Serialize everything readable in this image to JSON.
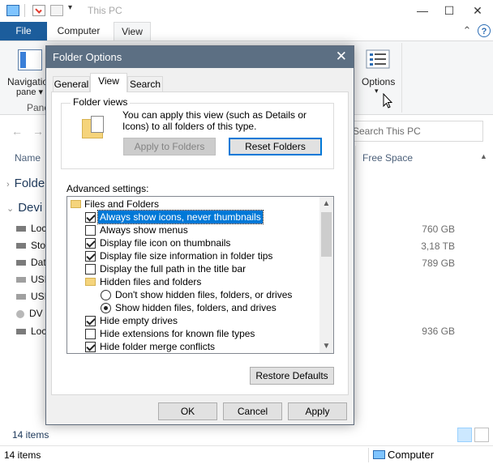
{
  "explorer": {
    "window_title": "This PC",
    "tabs": {
      "file": "File",
      "computer": "Computer",
      "view": "View"
    },
    "ribbon": {
      "nav_pane_label_1": "Navigation",
      "nav_pane_label_2": "pane ▾",
      "panes_group_label": "Pane",
      "options_label": "Options",
      "options_arrow": "▾"
    },
    "search_placeholder": "Search This PC",
    "columns": {
      "name": "Name",
      "free_space": "Free Space"
    },
    "sidebar": {
      "folders": "Folde",
      "devices": "Devi"
    },
    "drives": [
      {
        "label": "Loc",
        "free": "760 GB"
      },
      {
        "label": "Sto",
        "free": "3,18 TB"
      },
      {
        "label": "Dat",
        "free": "789 GB"
      },
      {
        "label": "USI",
        "free": ""
      },
      {
        "label": "USI",
        "free": ""
      },
      {
        "label": "DV",
        "free": ""
      },
      {
        "label": "Loc",
        "free": "936 GB"
      }
    ],
    "item_count": "14 items",
    "status_left": "14 items",
    "status_right": "Computer"
  },
  "dialog": {
    "title": "Folder Options",
    "tabs": [
      "General",
      "View",
      "Search"
    ],
    "active_tab": "View",
    "folder_views": {
      "label": "Folder views",
      "description": "You can apply this view (such as Details or Icons) to all folders of this type.",
      "apply_button": "Apply to Folders",
      "reset_button": "Reset Folders"
    },
    "advanced_label": "Advanced settings:",
    "advanced_items": [
      {
        "kind": "folder",
        "text": "Files and Folders"
      },
      {
        "kind": "check",
        "checked": true,
        "selected": true,
        "text": "Always show icons, never thumbnails"
      },
      {
        "kind": "check",
        "checked": false,
        "text": "Always show menus"
      },
      {
        "kind": "check",
        "checked": true,
        "text": "Display file icon on thumbnails"
      },
      {
        "kind": "check",
        "checked": true,
        "text": "Display file size information in folder tips"
      },
      {
        "kind": "check",
        "checked": false,
        "text": "Display the full path in the title bar"
      },
      {
        "kind": "folder2",
        "text": "Hidden files and folders"
      },
      {
        "kind": "radio",
        "checked": false,
        "text": "Don't show hidden files, folders, or drives"
      },
      {
        "kind": "radio",
        "checked": true,
        "text": "Show hidden files, folders, and drives"
      },
      {
        "kind": "check",
        "checked": true,
        "text": "Hide empty drives"
      },
      {
        "kind": "check",
        "checked": false,
        "text": "Hide extensions for known file types"
      },
      {
        "kind": "check",
        "checked": true,
        "text": "Hide folder merge conflicts"
      }
    ],
    "restore_defaults": "Restore Defaults",
    "ok": "OK",
    "cancel": "Cancel",
    "apply": "Apply"
  }
}
